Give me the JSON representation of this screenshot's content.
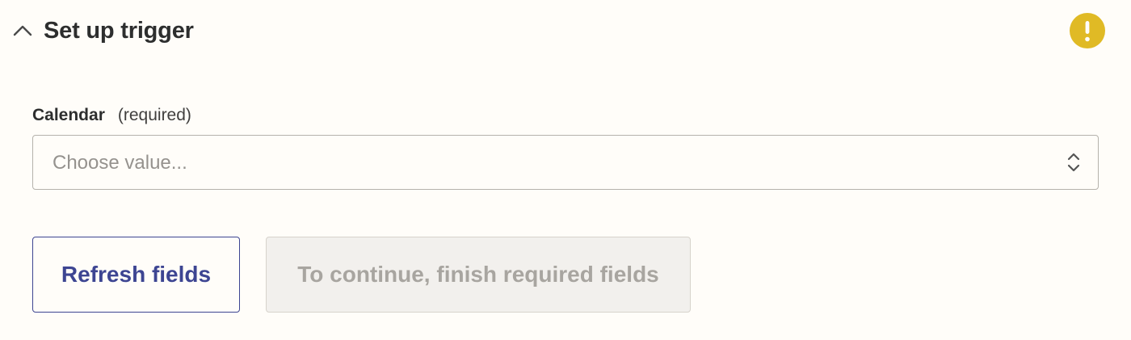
{
  "header": {
    "title": "Set up trigger",
    "toggle_icon": "chevron-up-icon",
    "status_icon": "warning-icon",
    "status_color": "#e0ba25"
  },
  "field": {
    "label": "Calendar",
    "required_text": "(required)",
    "placeholder": "Choose value...",
    "control_icon": "select-arrows-icon"
  },
  "actions": {
    "refresh_label": "Refresh fields",
    "continue_label": "To continue, finish required fields",
    "continue_disabled": true
  },
  "colors": {
    "accent": "#3d4592",
    "background": "#fffdf9",
    "disabled_background": "#f2f0ed",
    "disabled_text": "#a8a5a0"
  }
}
